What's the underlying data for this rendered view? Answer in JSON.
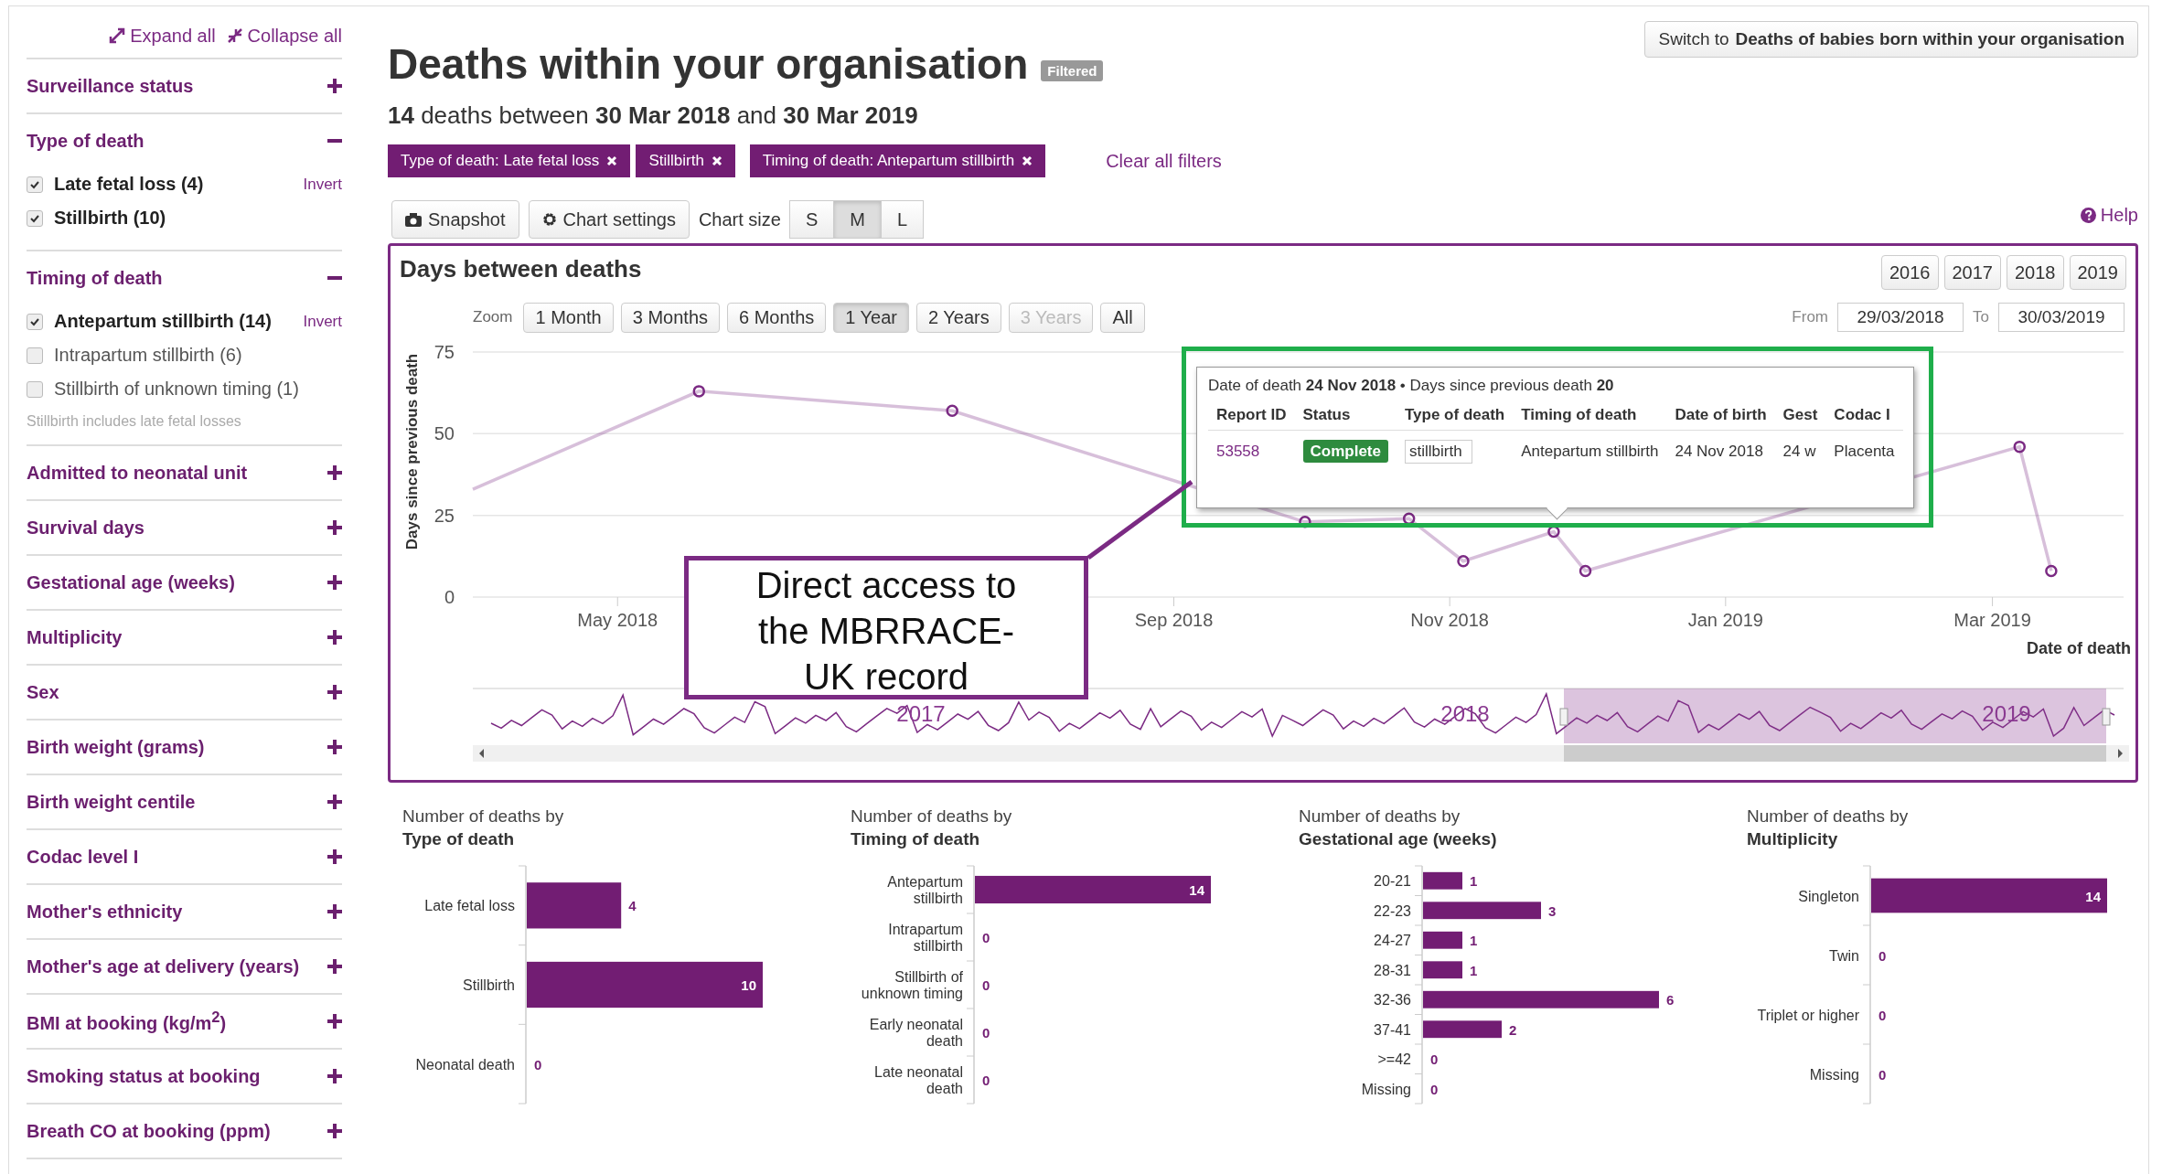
{
  "sidebar": {
    "expand_all": "Expand all",
    "collapse_all": "Collapse all",
    "sections": [
      {
        "title": "Surveillance status",
        "expanded": false
      },
      {
        "title": "Type of death",
        "expanded": true,
        "invert": "Invert",
        "options": [
          {
            "label": "Late fetal loss (4)",
            "checked": true
          },
          {
            "label": "Stillbirth (10)",
            "checked": true
          }
        ]
      },
      {
        "title": "Timing of death",
        "expanded": true,
        "invert": "Invert",
        "options": [
          {
            "label": "Antepartum stillbirth (14)",
            "checked": true
          },
          {
            "label": "Intrapartum stillbirth (6)",
            "checked": false
          },
          {
            "label": "Stillbirth of unknown timing (1)",
            "checked": false
          }
        ],
        "note": "Stillbirth includes late fetal losses"
      },
      {
        "title": "Admitted to neonatal unit",
        "expanded": false
      },
      {
        "title": "Survival days",
        "expanded": false
      },
      {
        "title": "Gestational age (weeks)",
        "expanded": false
      },
      {
        "title": "Multiplicity",
        "expanded": false
      },
      {
        "title": "Sex",
        "expanded": false
      },
      {
        "title": "Birth weight (grams)",
        "expanded": false
      },
      {
        "title": "Birth weight centile",
        "expanded": false
      },
      {
        "title": "Codac level I",
        "expanded": false
      },
      {
        "title": "Mother's ethnicity",
        "expanded": false
      },
      {
        "title": "Mother's age at delivery (years)",
        "expanded": false
      },
      {
        "title": "BMI at booking (kg/m$^{2}$)",
        "expanded": false
      },
      {
        "title": "Smoking status at booking",
        "expanded": false
      },
      {
        "title": "Breath CO at booking (ppm)",
        "expanded": false
      }
    ]
  },
  "header": {
    "title": "Deaths within your organisation",
    "badge": "Filtered",
    "switch_button": "Switch to **Deaths of babies born within your organisation**",
    "summary": "**14** deaths between **30 Mar 2018** and **30 Mar 2019**"
  },
  "filters": [
    {
      "label": "Type of death: Late fetal loss"
    },
    {
      "label": "Stillbirth"
    },
    {
      "label": "Timing of death: Antepartum stillbirth"
    }
  ],
  "clear_filters": "Clear all filters",
  "toolbar": {
    "snapshot": "Snapshot",
    "chart_settings": "Chart settings",
    "chart_size_label": "Chart size",
    "sizes": [
      {
        "label": "S",
        "selected": false
      },
      {
        "label": "M",
        "selected": true
      },
      {
        "label": "L",
        "selected": false
      }
    ],
    "help": "Help"
  },
  "main_chart": {
    "title": "Days between deaths",
    "years": [
      "2016",
      "2017",
      "2018",
      "2019"
    ],
    "zoom_label": "Zoom",
    "zoom_buttons": [
      {
        "label": "1 Month",
        "selected": false,
        "disabled": false
      },
      {
        "label": "3 Months",
        "selected": false,
        "disabled": false
      },
      {
        "label": "6 Months",
        "selected": false,
        "disabled": false
      },
      {
        "label": "1 Year",
        "selected": true,
        "disabled": false
      },
      {
        "label": "2 Years",
        "selected": false,
        "disabled": false
      },
      {
        "label": "3 Years",
        "selected": false,
        "disabled": true
      },
      {
        "label": "All",
        "selected": false,
        "disabled": false
      }
    ],
    "from_label": "From",
    "from_value": "29/03/2018",
    "to_label": "To",
    "to_value": "30/03/2019",
    "chart_data": {
      "type": "line",
      "xlabel": "Date of death",
      "ylabel": "Days since previous death",
      "xlim": [
        "2018-03-30",
        "2019-03-30"
      ],
      "ylim": [
        0,
        75
      ],
      "yticks": [
        0,
        25,
        50,
        75
      ],
      "xticks": [
        {
          "value": "2018-05-01",
          "label": "May 2018"
        },
        {
          "value": "2018-09-01",
          "label": "Sep 2018"
        },
        {
          "value": "2018-11-01",
          "label": "Nov 2018"
        },
        {
          "value": "2019-01-01",
          "label": "Jan 2019"
        },
        {
          "value": "2019-03-01",
          "label": "Mar 2019"
        }
      ],
      "x": [
        "2018-03-30",
        "2018-05-19",
        "2018-07-14",
        "2018-09-30",
        "2018-10-23",
        "2018-11-04",
        "2018-11-24",
        "2018-12-01",
        "2019-03-07",
        "2019-03-14"
      ],
      "series": [
        {
          "color": "#7b2a83",
          "marker": "circle",
          "values": [
            33,
            63,
            57,
            23,
            24,
            11,
            20,
            8,
            46,
            8
          ]
        }
      ]
    },
    "navigator_labels": [
      "2017",
      "2018",
      "2019"
    ],
    "tooltip": {
      "heading": "Date of death **24 Nov 2018** • Days since previous death **20**",
      "columns": [
        "Report ID",
        "Status",
        "Type of death",
        "Timing of death",
        "Date of birth",
        "Gest",
        "Codac I"
      ],
      "row": {
        "report_id": "53558",
        "status": "Complete",
        "type": "stillbirth",
        "timing": "Antepartum stillbirth",
        "dob": "24 Nov 2018",
        "gest": "24 w",
        "codac": "Placenta"
      }
    },
    "annotation": "Direct access to the MBRRACE-UK record"
  },
  "bar_charts": [
    {
      "title": "Number of deaths by",
      "subtitle": "Type of death",
      "chart_data": {
        "type": "bar",
        "orientation": "horizontal",
        "categories": [
          "Late fetal loss",
          "Stillbirth",
          "Neonatal death"
        ],
        "values": [
          4,
          10,
          0
        ],
        "data_labels": true
      }
    },
    {
      "title": "Number of deaths by",
      "subtitle": "Timing of death",
      "chart_data": {
        "type": "bar",
        "orientation": "horizontal",
        "categories": [
          "Antepartum stillbirth",
          "Intrapartum stillbirth",
          "Stillbirth of unknown timing",
          "Early neonatal death",
          "Late neonatal death"
        ],
        "values": [
          14,
          0,
          0,
          0,
          0
        ],
        "data_labels": true
      }
    },
    {
      "title": "Number of deaths by",
      "subtitle": "Gestational age (weeks)",
      "chart_data": {
        "type": "bar",
        "orientation": "horizontal",
        "categories": [
          "20-21",
          "22-23",
          "24-27",
          "28-31",
          "32-36",
          "37-41",
          ">=42",
          "Missing"
        ],
        "values": [
          1,
          3,
          1,
          1,
          6,
          2,
          0,
          0
        ],
        "data_labels": true
      }
    },
    {
      "title": "Number of deaths by",
      "subtitle": "Multiplicity",
      "chart_data": {
        "type": "bar",
        "orientation": "horizontal",
        "categories": [
          "Singleton",
          "Twin",
          "Triplet or higher",
          "Missing"
        ],
        "values": [
          14,
          0,
          0,
          0
        ],
        "data_labels": true
      }
    }
  ]
}
